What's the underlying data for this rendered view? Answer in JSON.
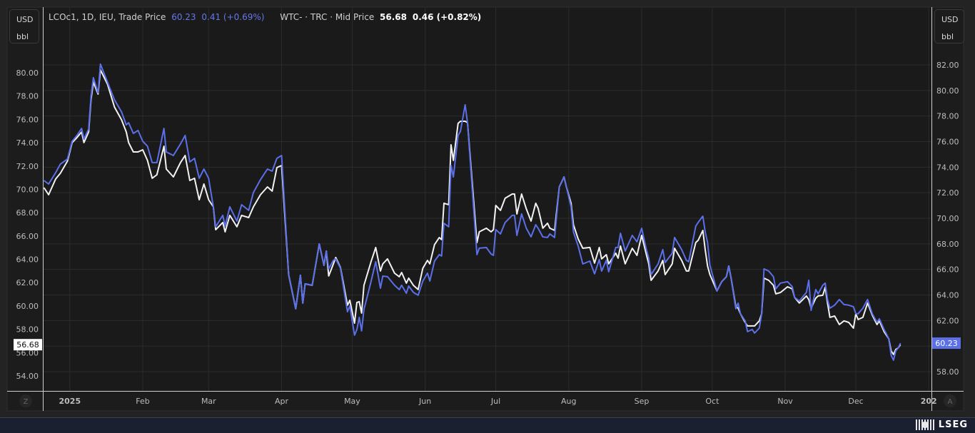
{
  "left_unit": {
    "currency": "USD",
    "unit": "bbl"
  },
  "right_unit": {
    "currency": "USD",
    "unit": "bbl"
  },
  "legend": {
    "series1": {
      "name": "LCOc1, 1D, IEU, Trade Price",
      "last": "60.23",
      "change": "0.41 (+0.69%)"
    },
    "series2": {
      "name": "WTC- · TRC · Mid Price",
      "last": "56.68",
      "change": "0.46 (+0.82%)"
    }
  },
  "buttons": {
    "z": "Z",
    "a": "A"
  },
  "branding": {
    "logo_text": "LSEG"
  },
  "chart_data": {
    "type": "line",
    "x_type": "date",
    "grid": true,
    "legend_placement": "top-left",
    "x_tick_labels": [
      "2025",
      "Feb",
      "Mar",
      "Apr",
      "May",
      "Jun",
      "Jul",
      "Aug",
      "Sep",
      "Oct",
      "Nov",
      "Dec",
      "202"
    ],
    "x_tick_dates": [
      "2025-01-01",
      "2025-02-01",
      "2025-03-01",
      "2025-04-01",
      "2025-05-01",
      "2025-06-01",
      "2025-07-01",
      "2025-08-01",
      "2025-09-01",
      "2025-10-01",
      "2025-11-01",
      "2025-12-01",
      "2026-01-01"
    ],
    "left_axis": {
      "series": "WTC- · TRC · Mid Price",
      "ylim": [
        54,
        80
      ],
      "ticks": [
        "54.00",
        "56.00",
        "58.00",
        "60.00",
        "62.00",
        "64.00",
        "66.00",
        "68.00",
        "70.00",
        "72.00",
        "74.00",
        "76.00",
        "78.00",
        "80.00"
      ],
      "last_label": "56.68"
    },
    "right_axis": {
      "series": "LCOc1, 1D, IEU, Trade Price",
      "ylim": [
        58,
        82
      ],
      "ticks": [
        "58.00",
        "60.00",
        "62.00",
        "64.00",
        "66.00",
        "68.00",
        "70.00",
        "72.00",
        "74.00",
        "76.00",
        "78.00",
        "80.00",
        "82.00"
      ],
      "last_label": "60.23"
    },
    "colors": {
      "LCOc1": "#5b6fe8",
      "WTC": "#f2f2f2",
      "last_left_bg": "#ffffff",
      "last_right_bg": "#5b6fe8"
    },
    "x": [
      "2024-12-21",
      "2024-12-23",
      "2024-12-26",
      "2024-12-28",
      "2024-12-31",
      "2025-01-02",
      "2025-01-04",
      "2025-01-06",
      "2025-01-07",
      "2025-01-09",
      "2025-01-10",
      "2025-01-11",
      "2025-01-13",
      "2025-01-14",
      "2025-01-17",
      "2025-01-20",
      "2025-01-23",
      "2025-01-25",
      "2025-01-26",
      "2025-01-28",
      "2025-01-30",
      "2025-02-01",
      "2025-02-03",
      "2025-02-05",
      "2025-02-07",
      "2025-02-10",
      "2025-02-11",
      "2025-02-14",
      "2025-02-17",
      "2025-02-19",
      "2025-02-21",
      "2025-02-23",
      "2025-02-25",
      "2025-02-27",
      "2025-03-01",
      "2025-03-03",
      "2025-03-04",
      "2025-03-07",
      "2025-03-08",
      "2025-03-10",
      "2025-03-13",
      "2025-03-15",
      "2025-03-18",
      "2025-03-20",
      "2025-03-23",
      "2025-03-26",
      "2025-03-28",
      "2025-03-30",
      "2025-04-01",
      "2025-04-04",
      "2025-04-07",
      "2025-04-09",
      "2025-04-10",
      "2025-04-11",
      "2025-04-14",
      "2025-04-17",
      "2025-04-19",
      "2025-04-20",
      "2025-04-21",
      "2025-04-23",
      "2025-04-24",
      "2025-04-26",
      "2025-04-29",
      "2025-04-30",
      "2025-05-02",
      "2025-05-03",
      "2025-05-04",
      "2025-05-05",
      "2025-05-06",
      "2025-05-09",
      "2025-05-11",
      "2025-05-13",
      "2025-05-14",
      "2025-05-16",
      "2025-05-19",
      "2025-05-21",
      "2025-05-22",
      "2025-05-24",
      "2025-05-25",
      "2025-05-27",
      "2025-05-29",
      "2025-05-31",
      "2025-06-02",
      "2025-06-03",
      "2025-06-05",
      "2025-06-07",
      "2025-06-08",
      "2025-06-09",
      "2025-06-11",
      "2025-06-12",
      "2025-06-13",
      "2025-06-15",
      "2025-06-16",
      "2025-06-18",
      "2025-06-19",
      "2025-06-23",
      "2025-06-24",
      "2025-06-27",
      "2025-06-29",
      "2025-06-30",
      "2025-07-01",
      "2025-07-03",
      "2025-07-05",
      "2025-07-08",
      "2025-07-09",
      "2025-07-10",
      "2025-07-12",
      "2025-07-14",
      "2025-07-16",
      "2025-07-18",
      "2025-07-19",
      "2025-07-21",
      "2025-07-23",
      "2025-07-24",
      "2025-07-26",
      "2025-07-28",
      "2025-07-30",
      "2025-07-31",
      "2025-08-02",
      "2025-08-03",
      "2025-08-05",
      "2025-08-07",
      "2025-08-10",
      "2025-08-12",
      "2025-08-14",
      "2025-08-15",
      "2025-08-17",
      "2025-08-18",
      "2025-08-21",
      "2025-08-22",
      "2025-08-23",
      "2025-08-25",
      "2025-08-28",
      "2025-08-30",
      "2025-09-01",
      "2025-09-03",
      "2025-09-04",
      "2025-09-05",
      "2025-09-08",
      "2025-09-10",
      "2025-09-11",
      "2025-09-14",
      "2025-09-15",
      "2025-09-18",
      "2025-09-20",
      "2025-09-21",
      "2025-09-24",
      "2025-09-25",
      "2025-09-27",
      "2025-09-28",
      "2025-09-29",
      "2025-09-30",
      "2025-10-03",
      "2025-10-05",
      "2025-10-07",
      "2025-10-08",
      "2025-10-09",
      "2025-10-11",
      "2025-10-12",
      "2025-10-13",
      "2025-10-15",
      "2025-10-16",
      "2025-10-18",
      "2025-10-19",
      "2025-10-21",
      "2025-10-22",
      "2025-10-23",
      "2025-10-25",
      "2025-10-27",
      "2025-10-28",
      "2025-10-30",
      "2025-11-02",
      "2025-11-04",
      "2025-11-05",
      "2025-11-07",
      "2025-11-10",
      "2025-11-11",
      "2025-11-12",
      "2025-11-14",
      "2025-11-15",
      "2025-11-17",
      "2025-11-18",
      "2025-11-19",
      "2025-11-20",
      "2025-11-22",
      "2025-11-24",
      "2025-11-26",
      "2025-11-28",
      "2025-11-30",
      "2025-12-01",
      "2025-12-02",
      "2025-12-04",
      "2025-12-06",
      "2025-12-08",
      "2025-12-10",
      "2025-12-11",
      "2025-12-13",
      "2025-12-14",
      "2025-12-15",
      "2025-12-16",
      "2025-12-17",
      "2025-12-18",
      "2025-12-19",
      "2025-12-20"
    ],
    "series": [
      {
        "name": "LCOc1, 1D, IEU, Trade Price",
        "axis": "right",
        "values": [
          72.96,
          72.68,
          73.57,
          74.24,
          74.63,
          76.03,
          76.48,
          77.03,
          76.2,
          76.98,
          79.54,
          81.0,
          79.82,
          82.06,
          80.66,
          79.27,
          78.32,
          77.31,
          77.48,
          76.64,
          76.87,
          76.03,
          75.64,
          74.36,
          74.36,
          77.03,
          75.19,
          74.91,
          75.81,
          76.48,
          74.41,
          74.69,
          73.13,
          73.85,
          73.13,
          70.9,
          69.33,
          70.23,
          69.39,
          70.9,
          69.78,
          71.06,
          70.62,
          72.01,
          73.02,
          73.85,
          73.69,
          74.69,
          74.91,
          65.59,
          62.92,
          65.54,
          63.36,
          64.87,
          64.76,
          67.99,
          66.32,
          67.44,
          66.04,
          66.71,
          66.82,
          66.1,
          62.69,
          63.14,
          60.85,
          61.3,
          62.25,
          61.19,
          62.86,
          65.04,
          66.6,
          64.53,
          65.48,
          65.43,
          64.76,
          64.42,
          64.76,
          64.14,
          64.7,
          64.2,
          63.98,
          65.09,
          65.71,
          65.09,
          66.65,
          67.16,
          67.05,
          69.61,
          69.33,
          74.13,
          73.24,
          76.48,
          76.81,
          78.88,
          77.48,
          67.16,
          67.66,
          67.71,
          67.21,
          67.1,
          69.11,
          68.78,
          69.67,
          70.23,
          70.23,
          68.66,
          70.34,
          69.22,
          68.55,
          69.5,
          69.22,
          68.55,
          68.5,
          68.78,
          68.5,
          72.46,
          73.24,
          72.46,
          70.9,
          68.94,
          67.83,
          66.43,
          66.65,
          65.65,
          66.77,
          65.87,
          66.71,
          65.82,
          67.72,
          67.72,
          68.83,
          67.44,
          68.66,
          68.16,
          69.22,
          67.55,
          66.88,
          65.59,
          66.43,
          67.55,
          66.54,
          67.27,
          68.5,
          67.55,
          66.71,
          66.6,
          69.39,
          69.67,
          70.17,
          68.94,
          68.11,
          66.32,
          64.31,
          65.04,
          65.43,
          66.26,
          65.32,
          62.92,
          63.36,
          62.53,
          61.97,
          61.13,
          61.3,
          61.02,
          61.41,
          62.53,
          66.04,
          65.87,
          65.43,
          64.48,
          64.93,
          65.04,
          64.65,
          63.81,
          63.53,
          64.2,
          65.15,
          62.8,
          64.42,
          64.09,
          64.76,
          64.93,
          63.64,
          62.97,
          63.2,
          63.64,
          63.25,
          63.2,
          63.08,
          62.53,
          62.53,
          62.97,
          63.64,
          62.53,
          61.86,
          62.14,
          61.3,
          60.96,
          60.57,
          59.29,
          58.9,
          59.62,
          59.85,
          60.23
        ]
      },
      {
        "name": "WTC- · TRC · Mid Price",
        "axis": "left",
        "values": [
          70.15,
          69.54,
          70.89,
          71.38,
          72.42,
          74.01,
          74.43,
          74.92,
          74.01,
          74.92,
          77.68,
          79.2,
          78.17,
          80.24,
          79.02,
          77.06,
          75.96,
          74.92,
          74.01,
          73.21,
          73.21,
          73.39,
          72.48,
          70.95,
          71.25,
          73.7,
          71.74,
          71.07,
          72.29,
          72.91,
          70.76,
          70.95,
          69.11,
          70.46,
          69.11,
          68.5,
          66.54,
          67.16,
          66.36,
          67.77,
          66.79,
          67.77,
          67.58,
          68.5,
          69.54,
          70.21,
          69.85,
          71.87,
          72.05,
          62.69,
          59.76,
          62.63,
          60.25,
          61.9,
          61.77,
          65.32,
          63.49,
          64.71,
          62.57,
          63.61,
          64.16,
          63.3,
          60.06,
          60.49,
          58.53,
          60.31,
          60.37,
          59.39,
          61.77,
          63.79,
          65.02,
          63.0,
          63.61,
          64.04,
          62.81,
          62.51,
          62.87,
          61.96,
          62.39,
          61.77,
          61.41,
          63.24,
          63.91,
          63.61,
          65.26,
          65.87,
          65.69,
          68.81,
          68.69,
          73.82,
          72.48,
          75.66,
          75.84,
          75.84,
          75.72,
          65.44,
          66.36,
          66.67,
          66.36,
          66.54,
          68.62,
          68.2,
          69.24,
          69.6,
          69.6,
          67.89,
          69.6,
          68.32,
          67.28,
          68.81,
          68.38,
          66.67,
          67.1,
          66.67,
          66.48,
          70.21,
          71.07,
          70.21,
          68.81,
          66.97,
          65.75,
          64.95,
          65.02,
          63.67,
          65.02,
          64.04,
          64.4,
          63.61,
          64.53,
          64.1,
          65.14,
          63.61,
          64.95,
          64.34,
          66.06,
          64.4,
          63.61,
          62.2,
          63.0,
          63.91,
          62.69,
          63.61,
          64.95,
          63.91,
          63.0,
          63.0,
          65.44,
          65.63,
          66.48,
          64.83,
          63.43,
          62.69,
          61.29,
          62.08,
          62.51,
          63.43,
          62.39,
          59.94,
          59.82,
          59.33,
          58.59,
          58.29,
          58.29,
          58.29,
          58.72,
          59.33,
          62.39,
          62.2,
          61.77,
          61.04,
          61.16,
          61.65,
          61.47,
          60.73,
          60.25,
          60.86,
          60.55,
          59.82,
          60.67,
          60.86,
          60.92,
          61.59,
          60.25,
          59.02,
          59.14,
          58.41,
          58.72,
          58.59,
          58.1,
          59.33,
          58.84,
          59.02,
          60.25,
          59.21,
          58.41,
          58.72,
          57.8,
          57.49,
          57.19,
          56.15,
          55.84,
          56.27,
          56.39,
          56.68
        ]
      }
    ]
  }
}
